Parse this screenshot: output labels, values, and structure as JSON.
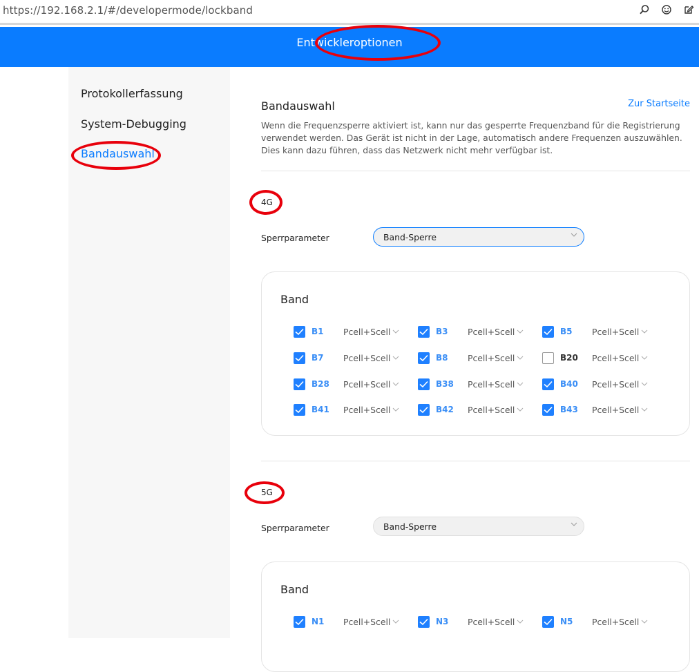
{
  "browser": {
    "url": "https://192.168.2.1/#/developermode/lockband",
    "icons": [
      "search-icon",
      "emoji-icon",
      "edit-icon"
    ]
  },
  "header": {
    "title": "Entwickleroptionen"
  },
  "sidebar": {
    "items": [
      {
        "label": "Protokollerfassung"
      },
      {
        "label": "System-Debugging"
      },
      {
        "label": "Bandauswahl"
      }
    ]
  },
  "main": {
    "title": "Bandauswahl",
    "home_link": "Zur Startseite",
    "description": "Wenn die Frequenzsperre aktiviert ist, kann nur das gesperrte Frequenzband für die Registrierung verwendet werden. Das Gerät ist nicht in der Lage, automatisch andere Frequenzen auszuwählen. Dies kann dazu führen, dass das Netzwerk nicht mehr verfügbar ist.",
    "lte": {
      "tag": "4G",
      "param_label": "Sperrparameter",
      "param_value": "Band-Sperre",
      "card_title": "Band",
      "bands": [
        {
          "name": "B1",
          "checked": true,
          "mode": "Pcell+Scell"
        },
        {
          "name": "B3",
          "checked": true,
          "mode": "Pcell+Scell"
        },
        {
          "name": "B5",
          "checked": true,
          "mode": "Pcell+Scell"
        },
        {
          "name": "B7",
          "checked": true,
          "mode": "Pcell+Scell"
        },
        {
          "name": "B8",
          "checked": true,
          "mode": "Pcell+Scell"
        },
        {
          "name": "B20",
          "checked": false,
          "mode": "Pcell+Scell"
        },
        {
          "name": "B28",
          "checked": true,
          "mode": "Pcell+Scell"
        },
        {
          "name": "B38",
          "checked": true,
          "mode": "Pcell+Scell"
        },
        {
          "name": "B40",
          "checked": true,
          "mode": "Pcell+Scell"
        },
        {
          "name": "B41",
          "checked": true,
          "mode": "Pcell+Scell"
        },
        {
          "name": "B42",
          "checked": true,
          "mode": "Pcell+Scell"
        },
        {
          "name": "B43",
          "checked": true,
          "mode": "Pcell+Scell"
        }
      ]
    },
    "nr": {
      "tag": "5G",
      "param_label": "Sperrparameter",
      "param_value": "Band-Sperre",
      "card_title": "Band",
      "bands": [
        {
          "name": "N1",
          "checked": true,
          "mode": "Pcell+Scell"
        },
        {
          "name": "N3",
          "checked": true,
          "mode": "Pcell+Scell"
        },
        {
          "name": "N5",
          "checked": true,
          "mode": "Pcell+Scell"
        }
      ]
    }
  },
  "colors": {
    "accent": "#0a7cff",
    "annotation": "#e8000b",
    "checkbox": "#1f80ff"
  }
}
